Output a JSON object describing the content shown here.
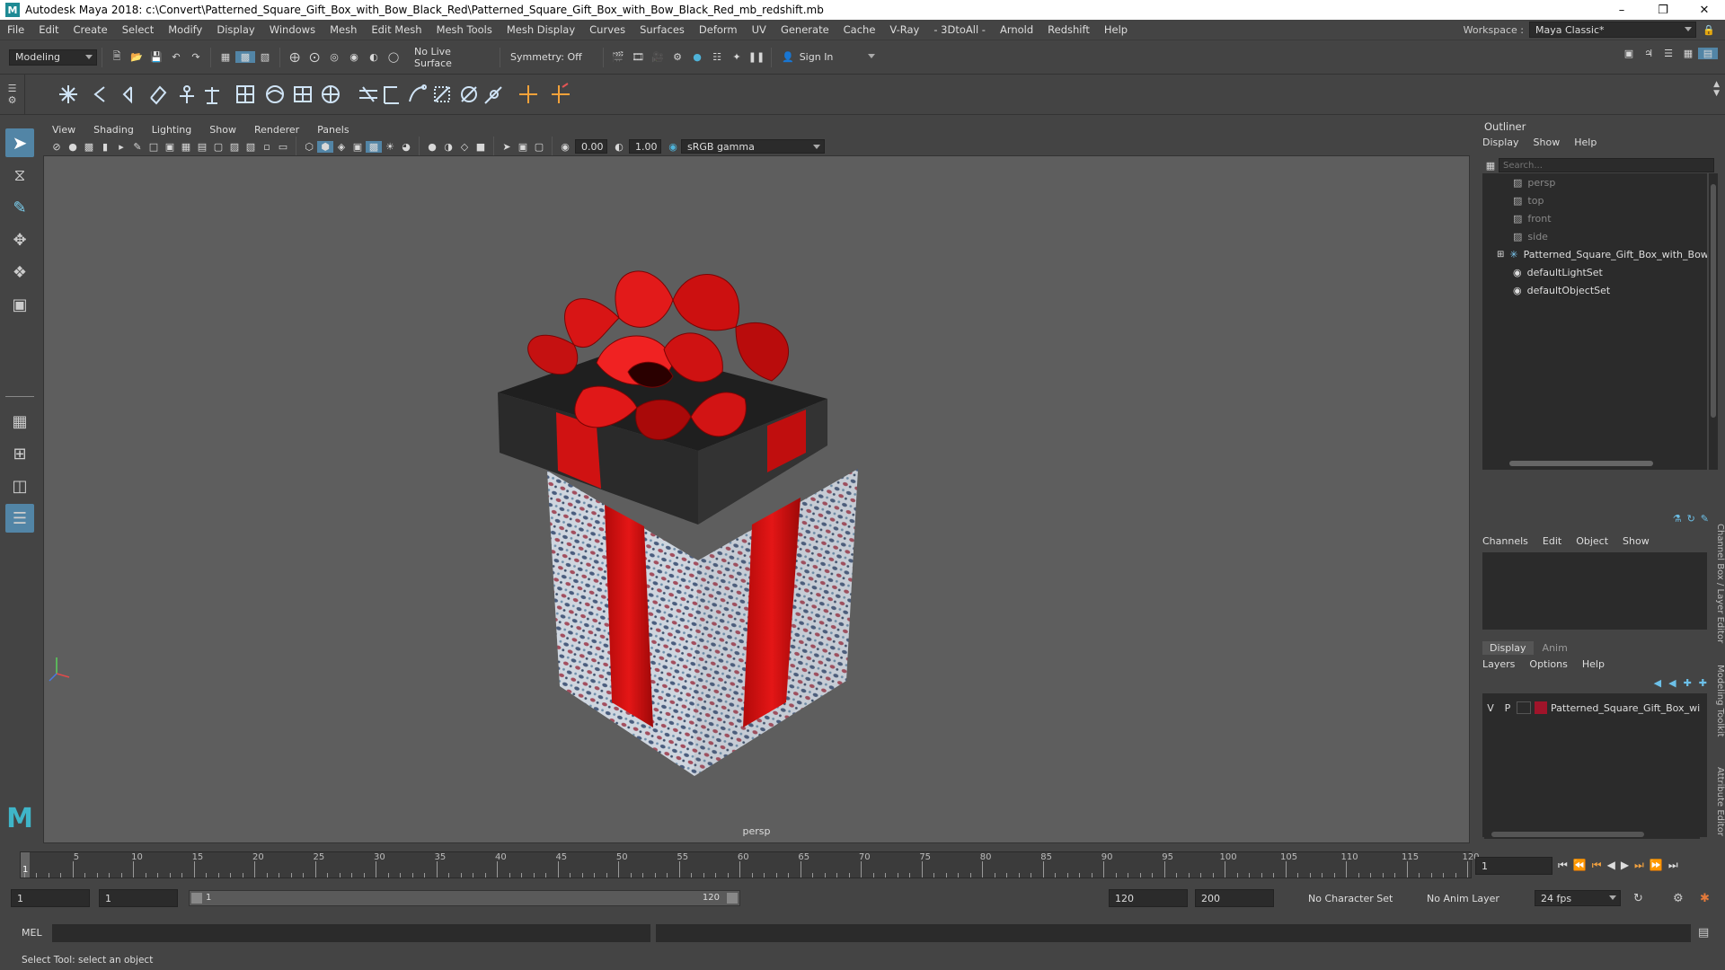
{
  "window": {
    "title": "Autodesk Maya 2018: c:\\Convert\\Patterned_Square_Gift_Box_with_Bow_Black_Red\\Patterned_Square_Gift_Box_with_Bow_Black_Red_mb_redshift.mb",
    "logo": "M"
  },
  "menubar": {
    "items": [
      "File",
      "Edit",
      "Create",
      "Select",
      "Modify",
      "Display",
      "Windows",
      "Mesh",
      "Edit Mesh",
      "Mesh Tools",
      "Mesh Display",
      "Curves",
      "Surfaces",
      "Deform",
      "UV",
      "Generate",
      "Cache",
      "V-Ray",
      "- 3DtoAll -",
      "Arnold",
      "Redshift",
      "Help"
    ]
  },
  "workspace": {
    "label": "Workspace :",
    "value": "Maya Classic*"
  },
  "statusline": {
    "mode": "Modeling",
    "live_surface": "No Live Surface",
    "symmetry": "Symmetry: Off",
    "sign_in": "Sign In"
  },
  "viewport": {
    "menu": [
      "View",
      "Shading",
      "Lighting",
      "Show",
      "Renderer",
      "Panels"
    ],
    "exposure": "0.00",
    "gamma": "1.00",
    "color_space": "sRGB gamma",
    "camera": "persp"
  },
  "outliner": {
    "title": "Outliner",
    "menu": [
      "Display",
      "Show",
      "Help"
    ],
    "search_placeholder": "Search...",
    "items": [
      {
        "label": "persp",
        "icon": "camera-icon",
        "dim": true
      },
      {
        "label": "top",
        "icon": "camera-icon",
        "dim": true
      },
      {
        "label": "front",
        "icon": "camera-icon",
        "dim": true
      },
      {
        "label": "side",
        "icon": "camera-icon",
        "dim": true
      },
      {
        "label": "Patterned_Square_Gift_Box_with_Bow_B",
        "icon": "group-icon",
        "dim": false
      },
      {
        "label": "defaultLightSet",
        "icon": "set-icon",
        "dim": false
      },
      {
        "label": "defaultObjectSet",
        "icon": "set-icon",
        "dim": false
      }
    ]
  },
  "channelbox": {
    "menu": [
      "Channels",
      "Edit",
      "Object",
      "Show"
    ]
  },
  "layers": {
    "tabs": [
      "Display",
      "Anim"
    ],
    "menu": [
      "Layers",
      "Options",
      "Help"
    ],
    "row": {
      "v": "V",
      "p": "P",
      "name": "Patterned_Square_Gift_Box_wi",
      "color": "#a0142a"
    }
  },
  "side_tabs": [
    "Channel Box / Layer Editor",
    "Modeling Toolkit",
    "Attribute Editor"
  ],
  "timeline": {
    "ticks": [
      5,
      10,
      15,
      20,
      25,
      30,
      35,
      40,
      45,
      50,
      55,
      60,
      65,
      70,
      75,
      80,
      85,
      90,
      95,
      100,
      105,
      110,
      115,
      120
    ],
    "start_label": "1",
    "current_frame": "1"
  },
  "range": {
    "start": "1",
    "playback_start": "1",
    "slider_start": "1",
    "slider_end": "120",
    "playback_end": "120",
    "end": "200",
    "character_set": "No Character Set",
    "anim_layer": "No Anim Layer",
    "fps": "24 fps"
  },
  "cmdline": {
    "label": "MEL"
  },
  "helpline": {
    "text": "Select Tool: select an object"
  }
}
